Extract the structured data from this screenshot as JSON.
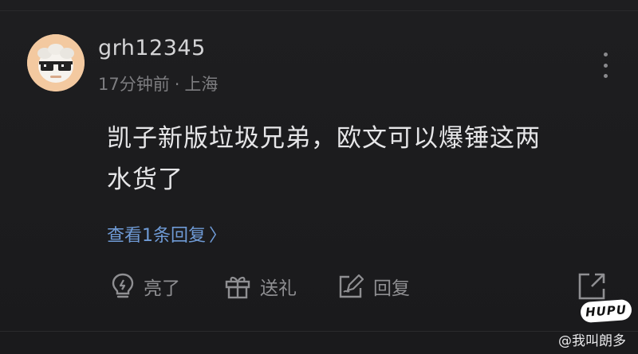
{
  "comment": {
    "username": "grh12345",
    "time": "17分钟前",
    "separator": "·",
    "location": "上海",
    "text_line1": "凯子新版垃圾兄弟，欧文可以爆锤这两",
    "text_line2": "水货了",
    "view_replies": "查看1条回复",
    "view_replies_chevron": "〉"
  },
  "actions": {
    "like_label": "亮了",
    "gift_label": "送礼",
    "reply_label": "回复"
  },
  "icons": {
    "more": "more-vertical-icon",
    "like": "lightbulb-icon",
    "gift": "gift-icon",
    "reply": "edit-reply-icon",
    "share": "share-external-icon"
  },
  "watermark": {
    "logo_text": "HUPU",
    "handle": "@我叫朗多"
  },
  "colors": {
    "background": "#1c1c1e",
    "text_primary": "#e6e6e8",
    "text_secondary": "#7d7d80",
    "link": "#6f9bd6",
    "avatar_bg": "#f3c9a0"
  }
}
